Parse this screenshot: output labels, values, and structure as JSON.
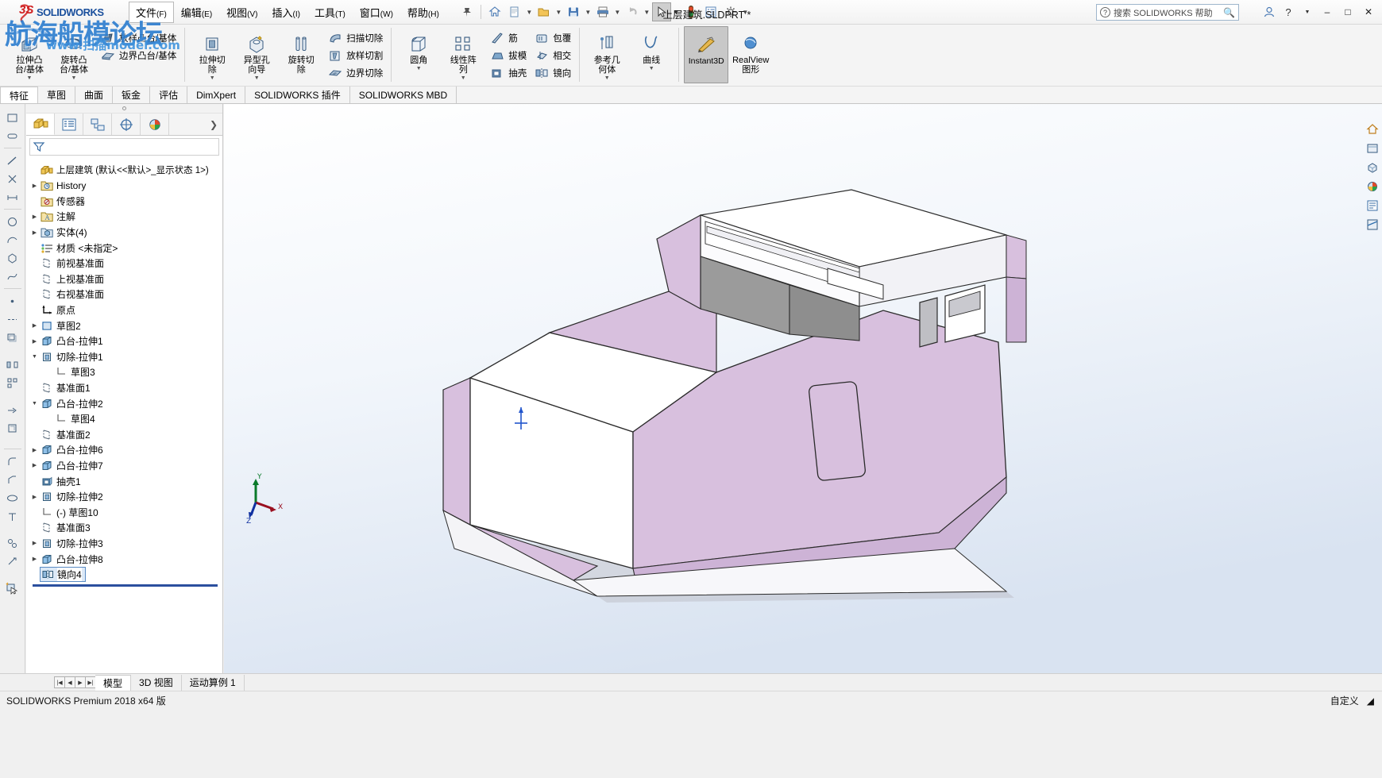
{
  "window": {
    "doc_title": "上层建筑.SLDPRT *",
    "app_name": "SOLIDWORKS",
    "logo_ds": "3S",
    "logo_text": "SOLIDWORKS"
  },
  "watermark": {
    "line1": "航海船模论坛",
    "line2": "www.扫描model.com"
  },
  "menu": [
    {
      "label": "文件",
      "mnemonic": "(F)",
      "boxed": true
    },
    {
      "label": "编辑",
      "mnemonic": "(E)",
      "boxed": false
    },
    {
      "label": "视图",
      "mnemonic": "(V)",
      "boxed": false
    },
    {
      "label": "插入",
      "mnemonic": "(I)",
      "boxed": false
    },
    {
      "label": "工具",
      "mnemonic": "(T)",
      "boxed": false
    },
    {
      "label": "窗口",
      "mnemonic": "(W)",
      "boxed": false
    },
    {
      "label": "帮助",
      "mnemonic": "(H)",
      "boxed": false
    }
  ],
  "quick_access": [
    {
      "name": "pin-icon",
      "glyph": "📌"
    },
    {
      "name": "new-doc-icon",
      "glyph": "🏠"
    },
    {
      "name": "new-file-icon",
      "glyph": ""
    },
    {
      "name": "open-icon",
      "glyph": ""
    },
    {
      "name": "save-icon",
      "glyph": ""
    },
    {
      "name": "print-icon",
      "glyph": ""
    },
    {
      "name": "undo-icon",
      "glyph": "↺"
    },
    {
      "name": "select-icon",
      "glyph": ""
    },
    {
      "name": "rebuild-icon",
      "glyph": ""
    },
    {
      "name": "options-icon",
      "glyph": "⚙"
    }
  ],
  "help_search": {
    "placeholder": "搜索 SOLIDWORKS 帮助",
    "icon": "question-mark-icon"
  },
  "ribbon": {
    "groups": [
      {
        "name": "boss-base-group",
        "big": [
          {
            "label1": "拉伸凸",
            "label2": "台/基体",
            "icon": "extrude-boss-icon",
            "dropdown": true
          },
          {
            "label1": "旋转凸",
            "label2": "台/基体",
            "icon": "revolve-boss-icon",
            "dropdown": true
          }
        ],
        "small": [
          {
            "label": "放样凸台/基体",
            "icon": "loft-boss-icon"
          },
          {
            "label": "边界凸台/基体",
            "icon": "boundary-boss-icon"
          }
        ]
      },
      {
        "name": "cut-group",
        "big": [
          {
            "label1": "拉伸切",
            "label2": "除",
            "icon": "extrude-cut-icon",
            "dropdown": true
          },
          {
            "label1": "异型孔",
            "label2": "向导",
            "icon": "hole-wizard-icon",
            "dropdown": true
          },
          {
            "label1": "旋转切",
            "label2": "除",
            "icon": "revolve-cut-icon",
            "dropdown": false
          }
        ],
        "small": [
          {
            "label": "扫描切除",
            "icon": "sweep-cut-icon"
          },
          {
            "label": "放样切割",
            "icon": "loft-cut-icon"
          },
          {
            "label": "边界切除",
            "icon": "boundary-cut-icon"
          }
        ]
      },
      {
        "name": "feature-group",
        "big": [
          {
            "label1": "圆角",
            "label2": "",
            "icon": "fillet-icon",
            "dropdown": true
          },
          {
            "label1": "线性阵",
            "label2": "列",
            "icon": "linear-pattern-icon",
            "dropdown": true
          }
        ],
        "small": [
          {
            "label": "筋",
            "icon": "rib-icon"
          },
          {
            "label": "拔模",
            "icon": "draft-icon"
          },
          {
            "label": "抽壳",
            "icon": "shell-icon"
          }
        ],
        "small2": [
          {
            "label": "包覆",
            "icon": "wrap-icon"
          },
          {
            "label": "相交",
            "icon": "intersect-icon"
          },
          {
            "label": "镜向",
            "icon": "mirror-icon"
          }
        ]
      },
      {
        "name": "reference-group",
        "big": [
          {
            "label1": "参考几",
            "label2": "何体",
            "icon": "reference-geometry-icon",
            "dropdown": true
          },
          {
            "label1": "曲线",
            "label2": "",
            "icon": "curves-icon",
            "dropdown": true
          }
        ]
      },
      {
        "name": "instant3d-group",
        "big": [
          {
            "label1": "Instant3D",
            "label2": "",
            "icon": "instant3d-icon",
            "dropdown": false,
            "active": true
          },
          {
            "label1": "RealView",
            "label2": "图形",
            "icon": "realview-icon",
            "dropdown": false
          }
        ]
      }
    ]
  },
  "command_tabs": [
    {
      "label": "特征",
      "active": true
    },
    {
      "label": "草图",
      "active": false
    },
    {
      "label": "曲面",
      "active": false
    },
    {
      "label": "钣金",
      "active": false
    },
    {
      "label": "评估",
      "active": false
    },
    {
      "label": "DimXpert",
      "active": false
    },
    {
      "label": "SOLIDWORKS 插件",
      "active": false
    },
    {
      "label": "SOLIDWORKS MBD",
      "active": false
    }
  ],
  "view_toolbar": [
    {
      "name": "zoom-to-fit-icon"
    },
    {
      "name": "zoom-area-icon"
    },
    {
      "name": "previous-view-icon"
    },
    {
      "name": "section-view-icon"
    },
    {
      "name": "view-orientation-icon"
    },
    {
      "name": "display-style-icon"
    },
    {
      "name": "hide-show-icon"
    },
    {
      "name": "edit-appearance-icon"
    },
    {
      "name": "apply-scene-icon"
    },
    {
      "name": "view-settings-icon"
    }
  ],
  "feature_manager": {
    "tabs": [
      {
        "name": "feature-tree-tab",
        "active": true
      },
      {
        "name": "property-manager-tab",
        "active": false
      },
      {
        "name": "configuration-manager-tab",
        "active": false
      },
      {
        "name": "dimxpert-manager-tab",
        "active": false
      },
      {
        "name": "display-manager-tab",
        "active": false
      }
    ],
    "filter_placeholder": "",
    "root": "上层建筑  (默认<<默认>_显示状态 1>)",
    "tree": [
      {
        "label": "History",
        "indent": 1,
        "arrow": true,
        "icon": "history-folder-icon"
      },
      {
        "label": "传感器",
        "indent": 1,
        "arrow": false,
        "icon": "sensors-folder-icon"
      },
      {
        "label": "注解",
        "indent": 1,
        "arrow": true,
        "icon": "annotations-folder-icon"
      },
      {
        "label": "实体(4)",
        "indent": 1,
        "arrow": true,
        "icon": "solid-bodies-folder-icon"
      },
      {
        "label": "材质 <未指定>",
        "indent": 1,
        "arrow": false,
        "icon": "material-icon"
      },
      {
        "label": "前视基准面",
        "indent": 1,
        "arrow": false,
        "icon": "plane-icon"
      },
      {
        "label": "上视基准面",
        "indent": 1,
        "arrow": false,
        "icon": "plane-icon"
      },
      {
        "label": "右视基准面",
        "indent": 1,
        "arrow": false,
        "icon": "plane-icon"
      },
      {
        "label": "原点",
        "indent": 1,
        "arrow": false,
        "icon": "origin-icon"
      },
      {
        "label": "草图2",
        "indent": 1,
        "arrow": true,
        "icon": "sketch-icon"
      },
      {
        "label": "凸台-拉伸1",
        "indent": 1,
        "arrow": true,
        "icon": "boss-extrude-icon"
      },
      {
        "label": "切除-拉伸1",
        "indent": 1,
        "arrow": true,
        "expanded": true,
        "icon": "cut-extrude-icon"
      },
      {
        "label": "草图3",
        "indent": 2,
        "arrow": false,
        "icon": "child-sketch-icon"
      },
      {
        "label": "基准面1",
        "indent": 1,
        "arrow": false,
        "icon": "plane-icon"
      },
      {
        "label": "凸台-拉伸2",
        "indent": 1,
        "arrow": true,
        "expanded": true,
        "icon": "boss-extrude-icon"
      },
      {
        "label": "草图4",
        "indent": 2,
        "arrow": false,
        "icon": "child-sketch-icon"
      },
      {
        "label": "基准面2",
        "indent": 1,
        "arrow": false,
        "icon": "plane-icon"
      },
      {
        "label": "凸台-拉伸6",
        "indent": 1,
        "arrow": true,
        "icon": "boss-extrude-icon"
      },
      {
        "label": "凸台-拉伸7",
        "indent": 1,
        "arrow": true,
        "icon": "boss-extrude-icon"
      },
      {
        "label": "抽壳1",
        "indent": 1,
        "arrow": false,
        "icon": "shell-feature-icon"
      },
      {
        "label": "切除-拉伸2",
        "indent": 1,
        "arrow": true,
        "icon": "cut-extrude-icon"
      },
      {
        "label": "(-) 草图10",
        "indent": 1,
        "arrow": false,
        "icon": "child-sketch-icon"
      },
      {
        "label": "基准面3",
        "indent": 1,
        "arrow": false,
        "icon": "plane-icon"
      },
      {
        "label": "切除-拉伸3",
        "indent": 1,
        "arrow": true,
        "icon": "cut-extrude-icon"
      },
      {
        "label": "凸台-拉伸8",
        "indent": 1,
        "arrow": true,
        "icon": "boss-extrude-icon"
      },
      {
        "label": "镜向4",
        "indent": 1,
        "arrow": false,
        "icon": "mirror-feature-icon",
        "selected": true
      }
    ]
  },
  "model": {
    "name": "上层建筑",
    "body_color": "#d8c0de",
    "deck_color": "#ffffff",
    "shadow_color": "#c6c6cc"
  },
  "bottom_tabs": [
    {
      "label": "模型",
      "active": true
    },
    {
      "label": "3D 视图",
      "active": false
    },
    {
      "label": "运动算例 1",
      "active": false
    }
  ],
  "status_bar": {
    "left": "SOLIDWORKS Premium 2018 x64 版",
    "right": "自定义"
  }
}
